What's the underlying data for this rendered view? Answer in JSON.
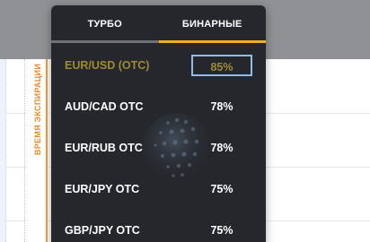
{
  "expiry_rail": {
    "label": "ВРЕМЯ ЭКСПИРАЦИИ"
  },
  "dropdown": {
    "tabs": [
      {
        "label": "ТУРБО",
        "active": false
      },
      {
        "label": "БИНАРНЫЕ",
        "active": true
      }
    ],
    "assets": [
      {
        "pair": "EUR/USD (OTC)",
        "payout": "85%",
        "selected": true
      },
      {
        "pair": "AUD/CAD OTC",
        "payout": "78%",
        "selected": false
      },
      {
        "pair": "EUR/RUB OTC",
        "payout": "78%",
        "selected": false
      },
      {
        "pair": "EUR/JPY OTC",
        "payout": "75%",
        "selected": false
      },
      {
        "pair": "GBP/JPY OTC",
        "payout": "75%",
        "selected": false
      }
    ]
  },
  "colors": {
    "panel_bg": "#25272c",
    "active_tab_accent": "#f2b01e",
    "selected_text": "#9e8a37",
    "selected_outline": "#8fbde8",
    "expiry_accent": "#e8892a"
  },
  "icons": {
    "background_watermark": "globe-icon"
  }
}
